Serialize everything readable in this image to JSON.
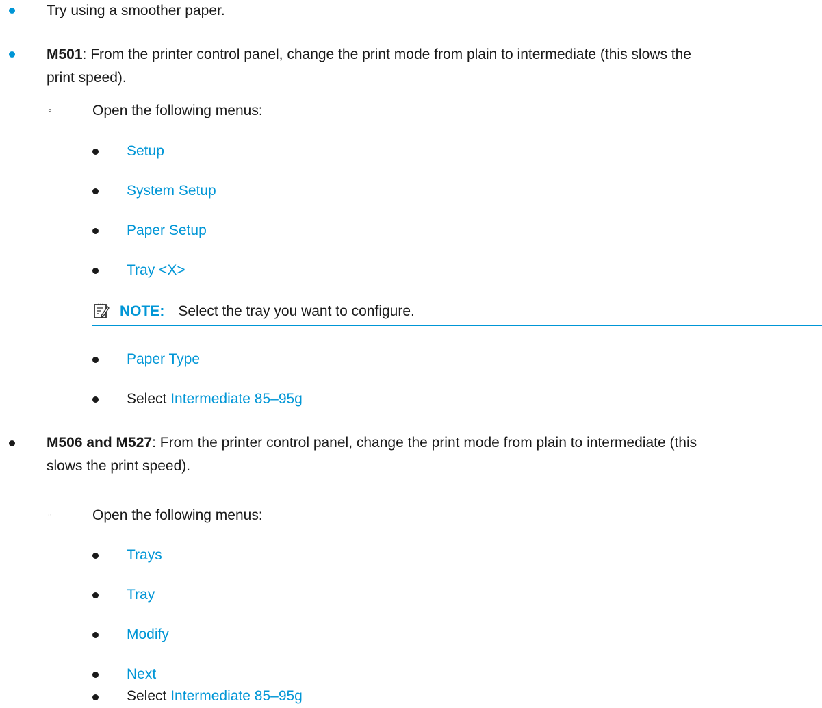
{
  "items": [
    {
      "text": "Try using a smoother paper."
    },
    {
      "bold": "M501",
      "rest_line1": ": From the printer control panel, change the print mode from plain to intermediate (this slows the",
      "rest_line2": "print speed)."
    },
    {
      "bold": "M506 and M527",
      "rest_line1": ": From the printer control panel, change the print mode from plain to intermediate (this",
      "rest_line2": "slows the print speed)."
    }
  ],
  "open_menus_label": "Open the following menus:",
  "m501_menus": [
    "Setup",
    "System Setup",
    "Paper Setup",
    "Tray <X>",
    "Paper Type"
  ],
  "m506_menus": [
    "Trays",
    "Tray",
    "Modify",
    "Next"
  ],
  "select_prefix": "Select",
  "select_value": "Intermediate 85–95g",
  "note": {
    "label": "NOTE:",
    "text": "Select the tray you want to configure."
  },
  "colors": {
    "accent": "#0096d6",
    "text": "#1a1a1a"
  },
  "icons": {
    "note": "note-pencil-icon"
  }
}
